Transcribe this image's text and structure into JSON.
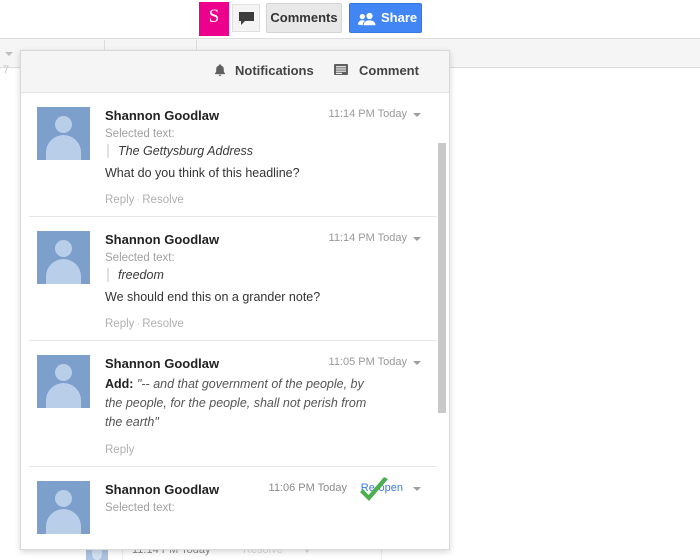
{
  "top_bar": {
    "app_badge_label": "S",
    "speech_icon": "speech-bubble-icon",
    "comments_button_label": "Comments",
    "share_button_label": "Share",
    "share_icon": "people-icon",
    "accent_pink": "#ec008c",
    "accent_blue": "#4285f4"
  },
  "panel": {
    "tabs": [
      {
        "label": "Notifications",
        "icon": "bell-icon"
      },
      {
        "label": "Comment",
        "icon": "document-icon"
      }
    ],
    "comments": [
      {
        "author": "Shannon Goodlaw",
        "time": "11:14 PM Today",
        "selected_text_label": "Selected text:",
        "quote": "The Gettysburg Address",
        "body": "What do you think of this headline?",
        "action_reply": "Reply",
        "action_separator": "·",
        "action_resolve": "Resolve"
      },
      {
        "author": "Shannon Goodlaw",
        "time": "11:14 PM Today",
        "selected_text_label": "Selected text:",
        "quote": "freedom",
        "body": "We should end this on a grander note?",
        "action_reply": "Reply",
        "action_separator": "·",
        "action_resolve": "Resolve"
      },
      {
        "author": "Shannon Goodlaw",
        "time": "11:05 PM Today",
        "add_prefix": "Add:",
        "body": "\"-- and that government of the people, by the people, for the people, shall not perish from the earth\"",
        "action_reply": "Reply"
      },
      {
        "author": "Shannon Goodlaw",
        "time": "11:06 PM Today",
        "meta_separator": "·",
        "reopen_label": "Re-open",
        "selected_text_label": "Selected text:",
        "resolved_icon": "green-check-icon",
        "resolved_color": "#4caf50"
      }
    ]
  },
  "background": {
    "zoom_value": "7",
    "strip_time": "11:14 PM Today",
    "strip_resolve": "Resolve"
  }
}
